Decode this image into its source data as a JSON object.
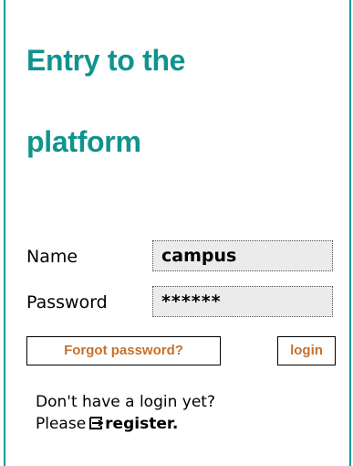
{
  "login_panel": {
    "title_line1": "Entry to the",
    "title_line2": "platform",
    "name_label": "Name",
    "name_value": "campus",
    "password_label": "Password",
    "password_value": "******",
    "forgot_label": "Forgot password?",
    "login_label": "login",
    "footer_question": "Don't have a login yet?",
    "footer_please": "Please",
    "register_label": "register.",
    "register_icon": "arrow-right-box-icon"
  },
  "colors": {
    "title": "#10938f",
    "panel_border": "#0a9a9a",
    "button_text": "#c8702a",
    "field_background": "#ebebeb"
  }
}
